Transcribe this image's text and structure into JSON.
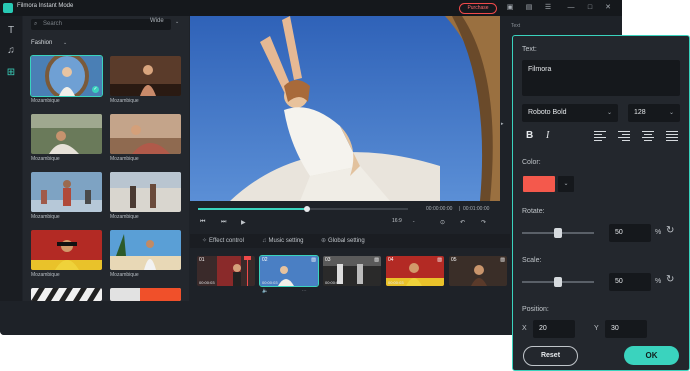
{
  "app": {
    "title": "Filmora Instant Mode",
    "purchase_label": "Purchase"
  },
  "titlebar_icons": [
    "save-icon",
    "save-as-icon",
    "menu-icon",
    "minimize-icon",
    "maximize-icon",
    "close-icon"
  ],
  "sidebar": {
    "items": [
      {
        "name": "text-icon",
        "glyph": "T"
      },
      {
        "name": "music-icon",
        "glyph": "♫"
      },
      {
        "name": "media-icon",
        "glyph": "⊞"
      }
    ]
  },
  "library": {
    "search_placeholder": "Search",
    "ratio_filter": "Wide",
    "category": "Fashion",
    "thumbnails": [
      {
        "label": "Mozambique"
      },
      {
        "label": "Mozambique"
      },
      {
        "label": "Mozambique"
      },
      {
        "label": "Mozambique"
      },
      {
        "label": "Mozambique"
      },
      {
        "label": "Mozambique"
      },
      {
        "label": "Mozambique"
      },
      {
        "label": "Mozambique"
      }
    ]
  },
  "player": {
    "progress_fraction": 0.52,
    "current_time": "00:00:00:00",
    "total_time": "00:01:00:00",
    "separator": "|",
    "aspect_ratio": "16:9"
  },
  "tabs": [
    {
      "label": "Effect control",
      "icon": "effect-icon"
    },
    {
      "label": "Music setting",
      "icon": "music-icon"
    },
    {
      "label": "Global setting",
      "icon": "globe-icon"
    }
  ],
  "timeline": {
    "clips": [
      {
        "num": "01",
        "duration": "00:00:03"
      },
      {
        "num": "02",
        "duration": "00:00:03"
      },
      {
        "num": "03",
        "duration": "00:00:03"
      },
      {
        "num": "04",
        "duration": "00:00:03"
      },
      {
        "num": "05",
        "duration": ""
      }
    ]
  },
  "right_panel_label": "Text",
  "text_panel": {
    "text_label": "Text:",
    "text_value": "Filmora",
    "font": "Roboto Bold",
    "size": "128",
    "bold_glyph": "B",
    "italic_glyph": "I",
    "color_label": "Color:",
    "color_value": "#f4594c",
    "rotate_label": "Rotate:",
    "rotate_value": "50",
    "rotate_unit": "%",
    "rotate_fraction": 0.5,
    "scale_label": "Scale:",
    "scale_value": "50",
    "scale_unit": "%",
    "scale_fraction": 0.5,
    "position_label": "Position:",
    "x_label": "X",
    "x_value": "20",
    "y_label": "Y",
    "y_value": "30",
    "reset_label": "Reset",
    "ok_label": "OK"
  },
  "colors": {
    "accent": "#3ad3be",
    "purchase": "#f04a4a"
  }
}
